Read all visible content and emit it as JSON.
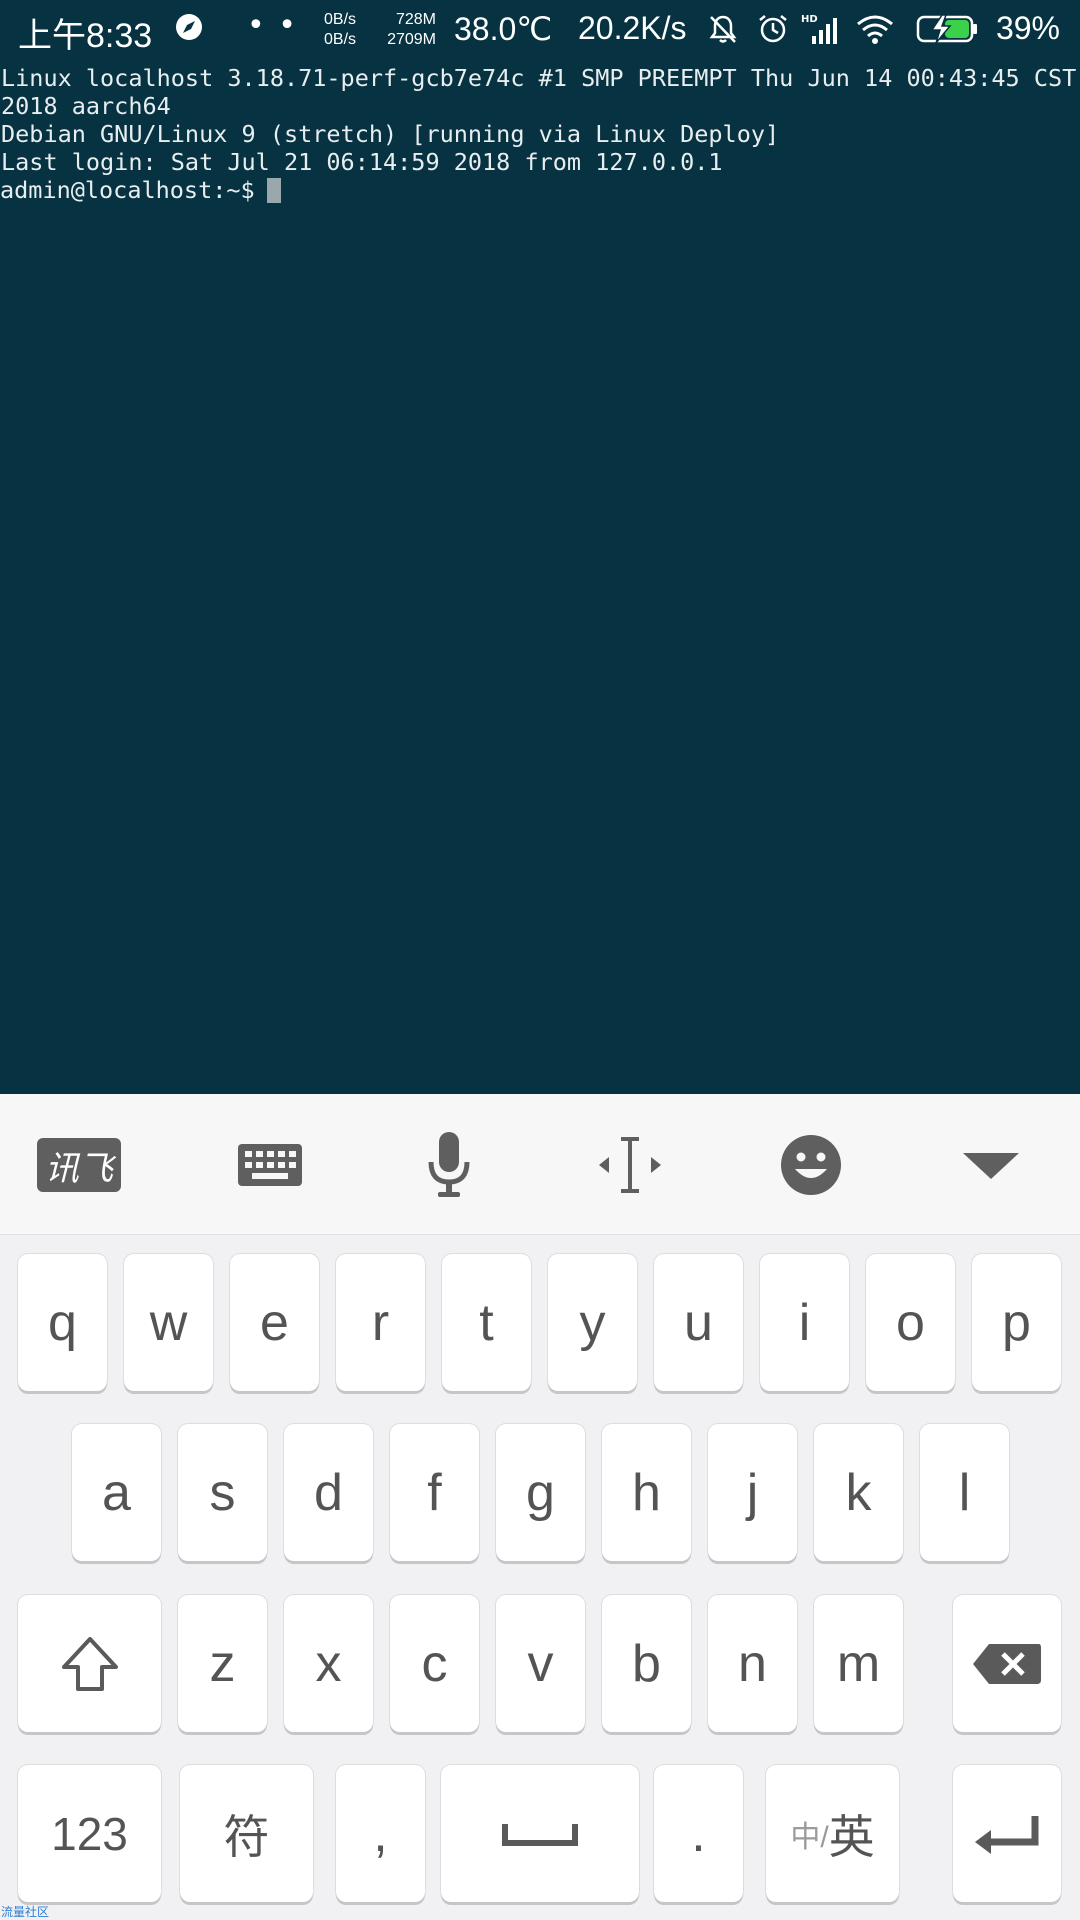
{
  "status_bar": {
    "time": "上午8:33",
    "dots": "• •",
    "net_up": "0B/s",
    "net_down": "0B/s",
    "mem_used": "728M",
    "mem_total": "2709M",
    "temperature": "38.0℃",
    "speed": "20.2K/s",
    "battery": "39%",
    "icons": [
      "compass-icon",
      "mute-icon",
      "alarm-icon",
      "hd-signal-icon",
      "wifi-icon",
      "battery-icon"
    ]
  },
  "terminal": {
    "lines": [
      "Linux localhost 3.18.71-perf-gcb7e74c #1 SMP PREEMPT Thu Jun 14 00:43:45 CST",
      "2018 aarch64",
      "Debian GNU/Linux 9 (stretch) [running via Linux Deploy]",
      "Last login: Sat Jul 21 06:14:59 2018 from 127.0.0.1"
    ],
    "prompt": "admin@localhost:~$"
  },
  "keyboard": {
    "toolbar": {
      "logo_text": "讯飞",
      "icons": [
        "xunfei-logo-icon",
        "keyboard-icon",
        "microphone-icon",
        "cursor-move-icon",
        "emoji-icon",
        "collapse-icon"
      ]
    },
    "row1": [
      "q",
      "w",
      "e",
      "r",
      "t",
      "y",
      "u",
      "i",
      "o",
      "p"
    ],
    "row2": [
      "a",
      "s",
      "d",
      "f",
      "g",
      "h",
      "j",
      "k",
      "l"
    ],
    "row3": [
      "z",
      "x",
      "c",
      "v",
      "b",
      "n",
      "m"
    ],
    "row4": {
      "numbers": "123",
      "symbols": "符",
      "comma": ",",
      "period": ".",
      "lang_small": "中/",
      "lang_big": "英"
    },
    "watermark": "流量社区"
  }
}
